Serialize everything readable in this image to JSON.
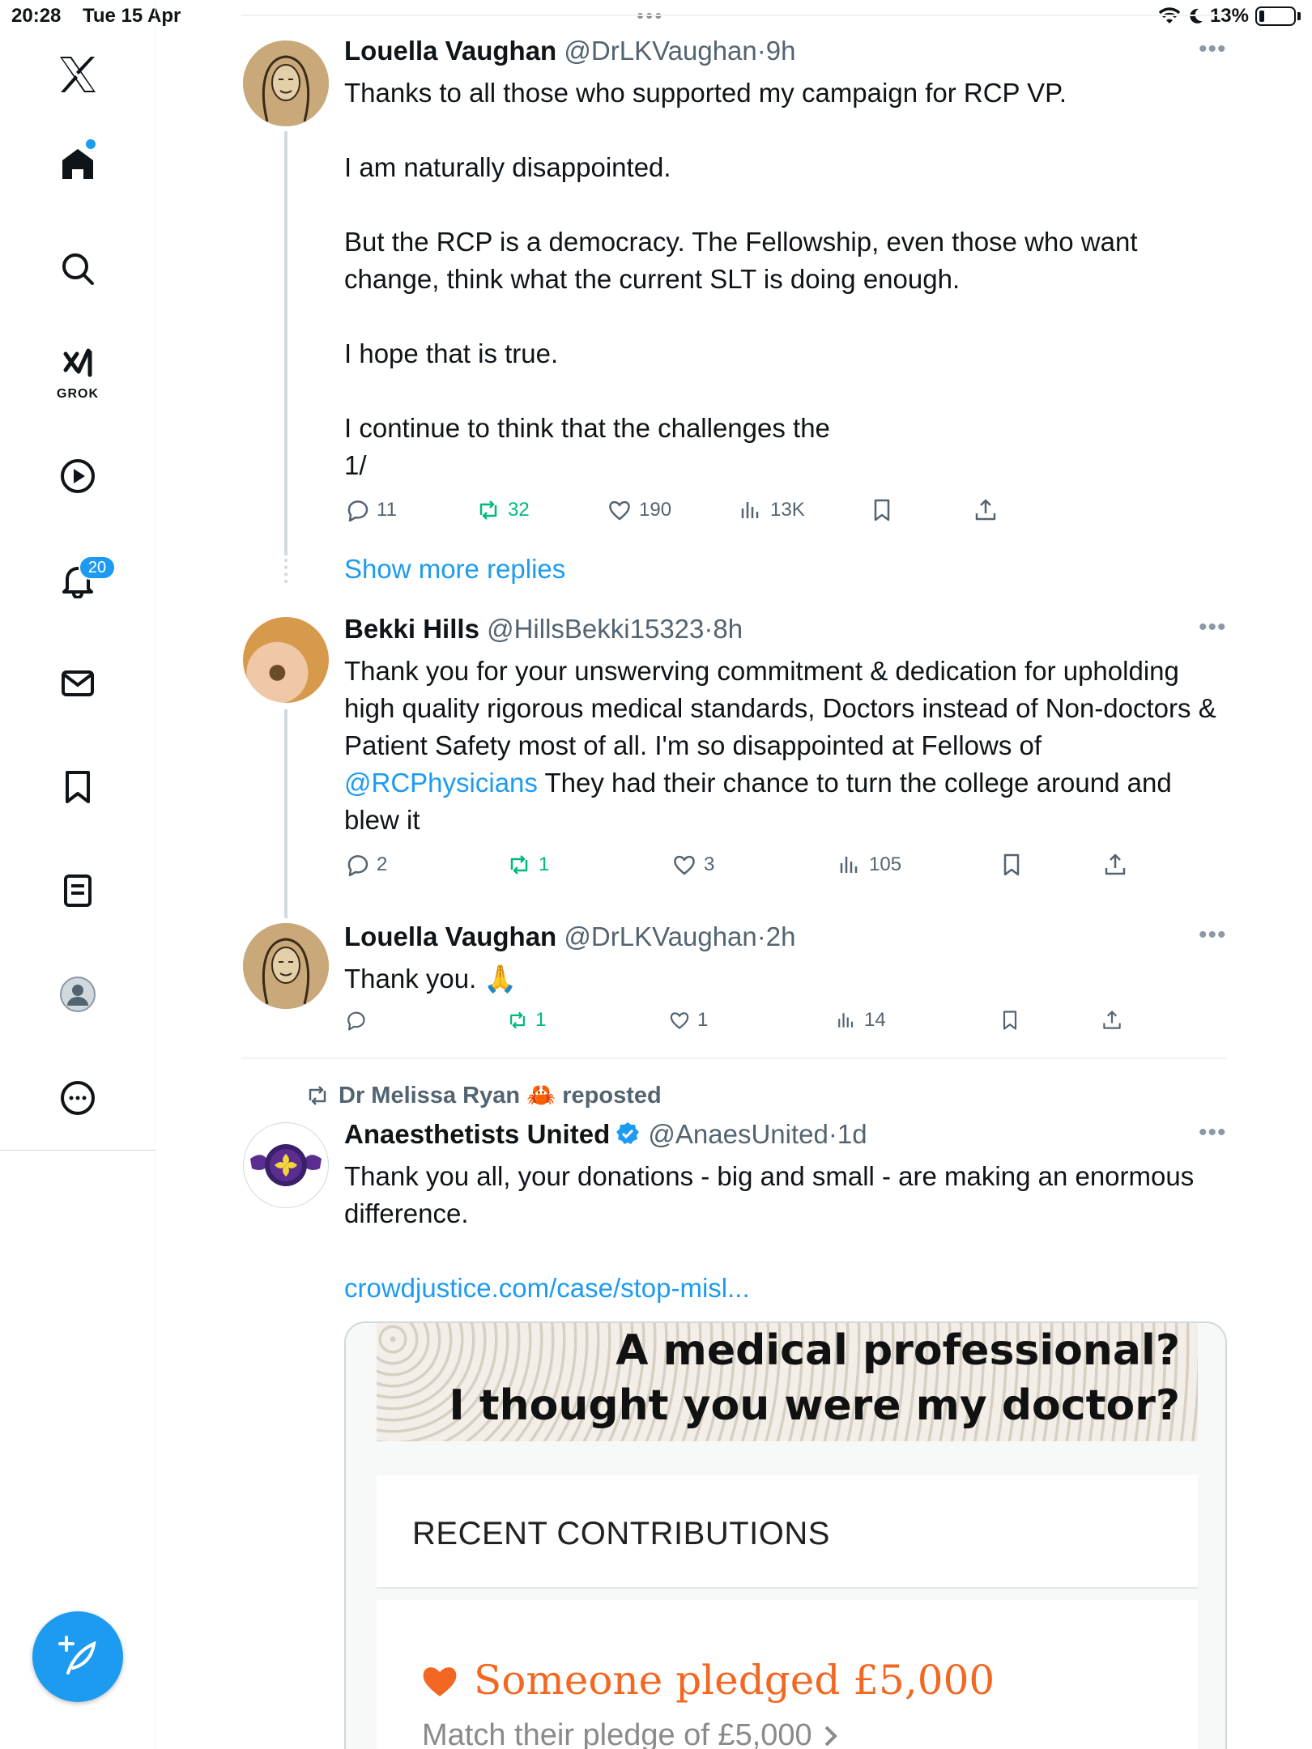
{
  "status_bar": {
    "time": "20:28",
    "date": "Tue 15 Apr",
    "battery": "13%"
  },
  "sidebar": {
    "grok_label": "GROK",
    "notification_count": "20",
    "accent": "#1d9bf0"
  },
  "tweets": [
    {
      "name": "Louella Vaughan",
      "handle": "@DrLKVaughan",
      "dot": "·",
      "time": "9h",
      "text": "Thanks to all those who supported my campaign for RCP VP.\n\nI am naturally disappointed.\n\nBut the RCP is a democracy. The Fellowship, even those who want change, think what the current SLT is doing enough.\n\nI hope that is true.\n\nI continue to think that the challenges the\n1/",
      "replies": "11",
      "reposts": "32",
      "likes": "190",
      "views": "13K"
    },
    {
      "name": "Bekki Hills",
      "handle": "@HillsBekki15323",
      "dot": "·",
      "time": "8h",
      "text_before": "Thank you for your unswerving commitment & dedication for upholding high quality rigorous medical standards, Doctors instead of Non-doctors & Patient Safety most of all. I'm so disappointed at Fellows of ",
      "mention": "@RCPhysicians",
      "text_after": " They had their chance to turn the college around and blew it",
      "replies": "2",
      "reposts": "1",
      "likes": "3",
      "views": "105"
    },
    {
      "name": "Louella Vaughan",
      "handle": "@DrLKVaughan",
      "dot": "·",
      "time": "2h",
      "text": "Thank you. 🙏",
      "replies": "",
      "reposts": "1",
      "likes": "1",
      "views": "14"
    },
    {
      "repost_by": "Dr Melissa Ryan 🦀 reposted",
      "name": "Anaesthetists United",
      "handle": "@AnaesUnited",
      "dot": "·",
      "time": "1d",
      "text": "Thank you all, your donations - big and small - are making an enormous difference.",
      "link": "crowdjustice.com/case/stop-misl...",
      "card": {
        "banner_line1": "A medical professional?",
        "banner_line2": "I thought you were my doctor?",
        "heading": "RECENT CONTRIBUTIONS",
        "pledge": "Someone pledged £5,000",
        "pledge_sub": "Match their pledge of £5,000",
        "pledge_color": "#f26722"
      }
    }
  ],
  "show_more_replies": "Show more replies",
  "more_glyph": "•••"
}
